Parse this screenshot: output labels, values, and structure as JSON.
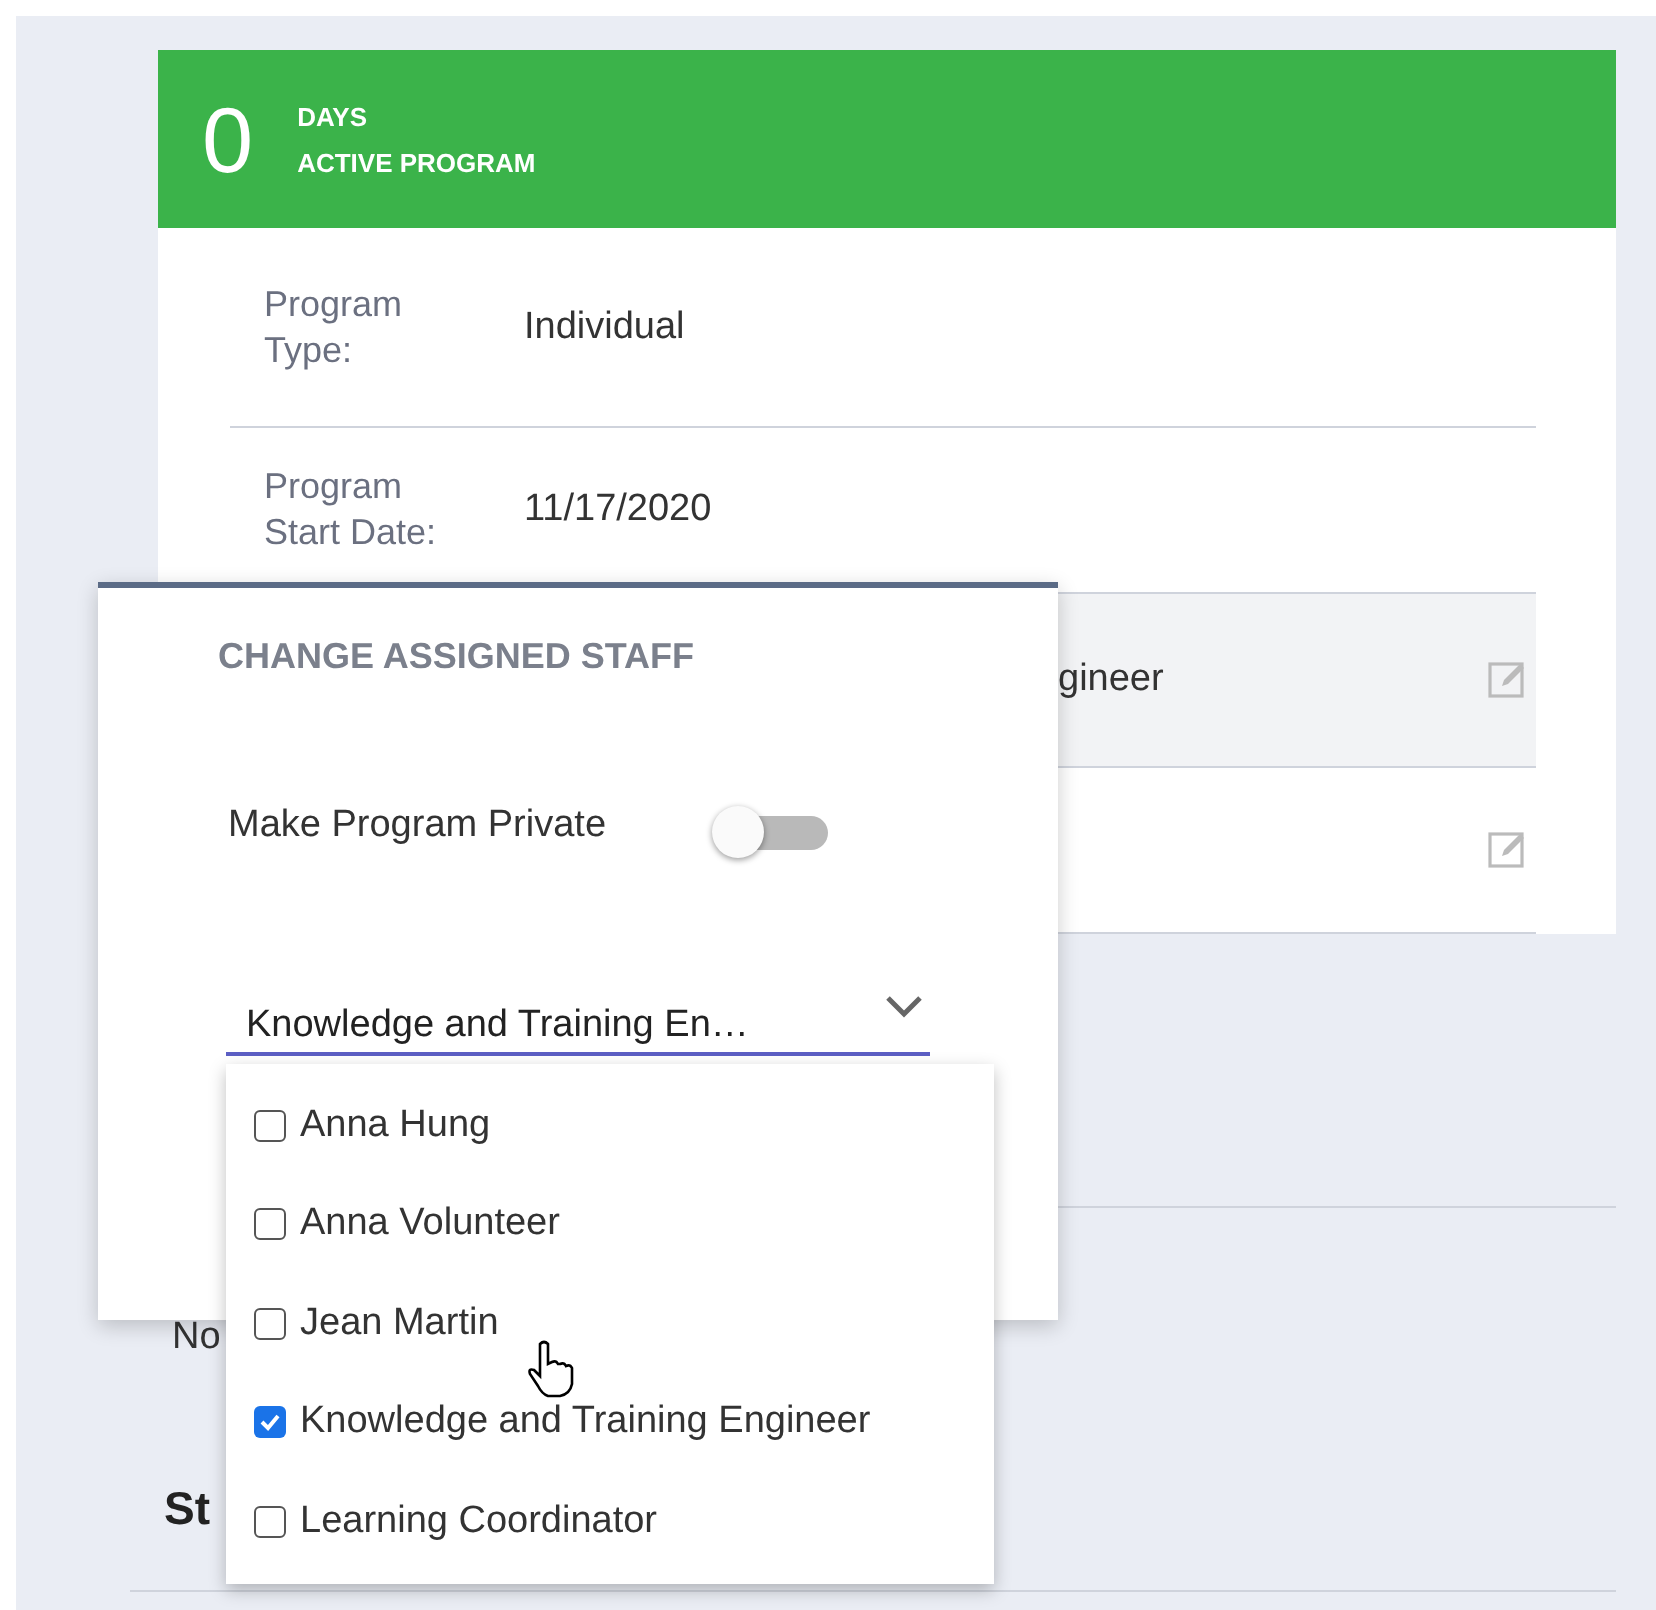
{
  "banner": {
    "count": "0",
    "unit": "DAYS",
    "label": "ACTIVE PROGRAM"
  },
  "details": [
    {
      "label": "Program Type:",
      "value": "Individual"
    },
    {
      "label": "Program Start Date:",
      "value": "11/17/2020"
    }
  ],
  "covered_rows": [
    {
      "fragment": "gineer",
      "highlighted": true
    },
    {
      "fragment": "",
      "highlighted": false
    }
  ],
  "below": {
    "fragment_1": "No",
    "heading_fragment": "St"
  },
  "dialog": {
    "title": "CHANGE ASSIGNED STAFF",
    "private_label": "Make Program Private",
    "private_on": false,
    "staff_select": {
      "value": "Knowledge and Training En…",
      "expanded": true
    }
  },
  "staff_options": [
    {
      "label": "Anna Hung",
      "checked": false
    },
    {
      "label": "Anna Volunteer",
      "checked": false
    },
    {
      "label": "Jean Martin",
      "checked": false
    },
    {
      "label": "Knowledge and Training Engineer",
      "checked": true
    },
    {
      "label": "Learning Coordinator",
      "checked": false
    }
  ]
}
